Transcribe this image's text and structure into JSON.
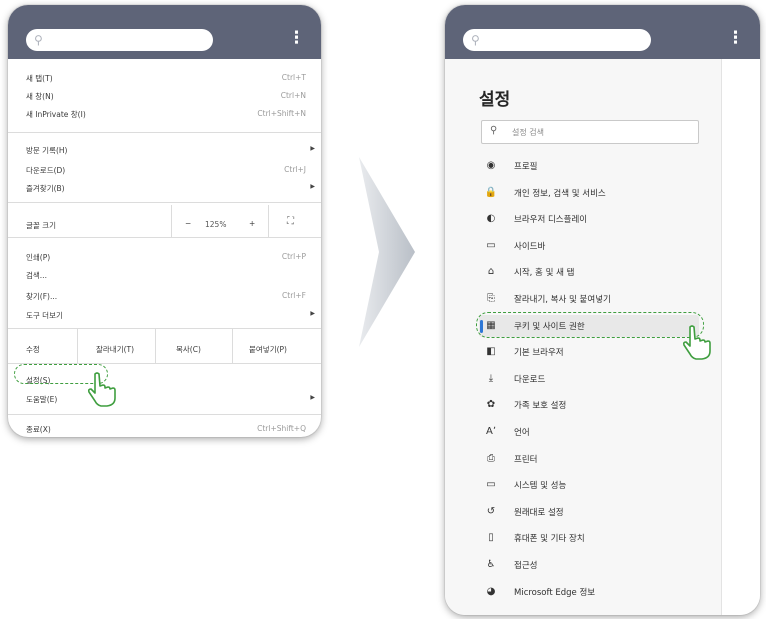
{
  "left_menu": {
    "items": [
      {
        "label": "새 탭(T)",
        "shortcut": "Ctrl+T"
      },
      {
        "label": "새 창(N)",
        "shortcut": "Ctrl+N"
      },
      {
        "label": "새 InPrivate 창(I)",
        "shortcut": "Ctrl+Shift+N"
      },
      {
        "label": "방문 기록(H)",
        "shortcut": ""
      },
      {
        "label": "다운로드(D)",
        "shortcut": "Ctrl+J"
      },
      {
        "label": "즐겨찾기(B)",
        "shortcut": ""
      },
      {
        "label": "글꼴 크기",
        "shortcut": ""
      },
      {
        "label": "인쇄(P)",
        "shortcut": "Ctrl+P"
      },
      {
        "label": "검색...",
        "shortcut": ""
      },
      {
        "label": "찾기(F)...",
        "shortcut": "Ctrl+F"
      },
      {
        "label": "도구 더보기",
        "shortcut": ""
      },
      {
        "label": "설정(S)",
        "shortcut": ""
      },
      {
        "label": "도움말(E)",
        "shortcut": ""
      },
      {
        "label": "종료(X)",
        "shortcut": "Ctrl+Shift+Q"
      }
    ],
    "zoom": {
      "minus": "−",
      "value": "125%",
      "plus": "+",
      "fullscreen": "⛶"
    },
    "edit_row": [
      "수정",
      "잘라내기(T)",
      "복사(C)",
      "붙여넣기(P)"
    ]
  },
  "settings": {
    "title": "설정",
    "search_placeholder": "설정 검색",
    "nav": [
      {
        "icon": "◉",
        "icon_name": "profile-icon",
        "label": "프로필"
      },
      {
        "icon": "🔒",
        "icon_name": "privacy-lock-icon",
        "label": "개인 정보, 검색 및 서비스"
      },
      {
        "icon": "◐",
        "icon_name": "appearance-icon",
        "label": "브라우저 디스플레이"
      },
      {
        "icon": "▭",
        "icon_name": "sidebar-icon",
        "label": "사이드바"
      },
      {
        "icon": "⌂",
        "icon_name": "home-icon",
        "label": "시작, 홈 및 새 탭"
      },
      {
        "icon": "⎘",
        "icon_name": "clipboard-icon",
        "label": "잘라내기, 복사 및 붙여넣기"
      },
      {
        "icon": "▦",
        "icon_name": "cookie-icon",
        "label": "쿠키 및 사이트 권한"
      },
      {
        "icon": "◧",
        "icon_name": "default-browser-icon",
        "label": "기본 브라우저"
      },
      {
        "icon": "⤓",
        "icon_name": "download-icon",
        "label": "다운로드"
      },
      {
        "icon": "✿",
        "icon_name": "family-icon",
        "label": "가족 보호 설정"
      },
      {
        "icon": "Aʼ",
        "icon_name": "language-icon",
        "label": "언어"
      },
      {
        "icon": "⎙",
        "icon_name": "printer-icon",
        "label": "프린터"
      },
      {
        "icon": "▭",
        "icon_name": "system-icon",
        "label": "시스템 및 성능"
      },
      {
        "icon": "↺",
        "icon_name": "reset-icon",
        "label": "원래대로 설정"
      },
      {
        "icon": "▯",
        "icon_name": "phone-icon",
        "label": "휴대폰 및 기타 장치"
      },
      {
        "icon": "♿",
        "icon_name": "accessibility-icon",
        "label": "접근성"
      },
      {
        "icon": "◕",
        "icon_name": "edge-logo-icon",
        "label": "Microsoft Edge 정보"
      }
    ],
    "selected_index": 6
  },
  "colors": {
    "topbar": "#5e6478",
    "highlight": "#3f9e3f",
    "accent": "#2d77d6"
  }
}
